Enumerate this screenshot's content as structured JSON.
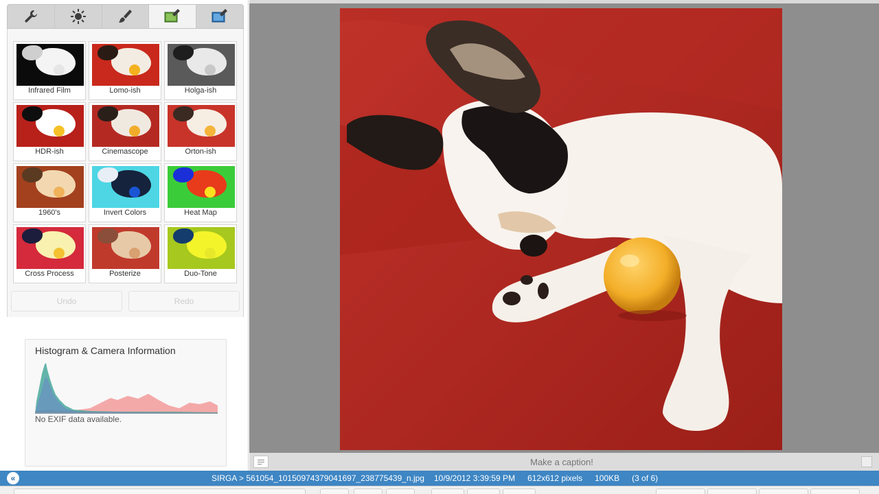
{
  "toolbar": {
    "tabs": [
      {
        "icon": "wrench-icon",
        "label": "Basic Fixes"
      },
      {
        "icon": "sun-icon",
        "label": "Tuning"
      },
      {
        "icon": "brush-icon",
        "label": "Effects"
      },
      {
        "icon": "film-brush-icon",
        "label": "Effects 2"
      },
      {
        "icon": "photo-brush-icon",
        "label": "Effects 3"
      }
    ]
  },
  "effects": [
    {
      "label": "Infrared Film",
      "bg": "#0b0b0b",
      "dog": "#f4f4f4",
      "accent": "#cfcfcf",
      "ball": "#e6e6e6"
    },
    {
      "label": "Lomo-ish",
      "bg": "#c9291c",
      "dog": "#f3ece2",
      "accent": "#2a1b14",
      "ball": "#f4b21e"
    },
    {
      "label": "Holga-ish",
      "bg": "#5a5a5a",
      "dog": "#e9e9e9",
      "accent": "#1e1e1e",
      "ball": "#c8c8c8"
    },
    {
      "label": "HDR-ish",
      "bg": "#b8201a",
      "dog": "#ffffff",
      "accent": "#0e0e0e",
      "ball": "#f6c126"
    },
    {
      "label": "Cinemascope",
      "bg": "#b42a22",
      "dog": "#f0e9e0",
      "accent": "#2b1f1a",
      "ball": "#f1ad2a"
    },
    {
      "label": "Orton-ish",
      "bg": "#c8342a",
      "dog": "#f6ede3",
      "accent": "#3a2a22",
      "ball": "#f5b43a"
    },
    {
      "label": "1960's",
      "bg": "#a3411e",
      "dog": "#f2d7b0",
      "accent": "#5b3a22",
      "ball": "#f0b25a"
    },
    {
      "label": "Invert Colors",
      "bg": "#4ed6e4",
      "dog": "#16233c",
      "accent": "#e8eef6",
      "ball": "#1a56d4"
    },
    {
      "label": "Heat Map",
      "bg": "#3bcc3a",
      "dog": "#e83b1b",
      "accent": "#1b2fd8",
      "ball": "#ffe020"
    },
    {
      "label": "Cross Process",
      "bg": "#d42a3c",
      "dog": "#f8f1b0",
      "accent": "#1c1c3c",
      "ball": "#f4c232"
    },
    {
      "label": "Posterize",
      "bg": "#c03a2c",
      "dog": "#e7c9a8",
      "accent": "#8a4e3a",
      "ball": "#d9a070"
    },
    {
      "label": "Duo-Tone",
      "bg": "#a7c81e",
      "dog": "#f4f42a",
      "accent": "#143c6c",
      "ball": "#e8e82a"
    }
  ],
  "history": {
    "undo": "Undo",
    "redo": "Redo"
  },
  "histogram": {
    "title": "Histogram & Camera Information",
    "exif": "No EXIF data available."
  },
  "caption": {
    "placeholder": "Make a caption!"
  },
  "status": {
    "path": "SIRGA > 561054_10150974379041697_238775439_n.jpg",
    "date": "10/9/2012 3:39:59 PM",
    "dimensions": "612x612 pixels",
    "size": "100KB",
    "position": "(3 of 6)",
    "collapse_glyph": "«"
  },
  "colors": {
    "status_bar": "#3e86c4",
    "viewer_bg": "#8e8e8e",
    "couch_red": "#b5271f"
  }
}
